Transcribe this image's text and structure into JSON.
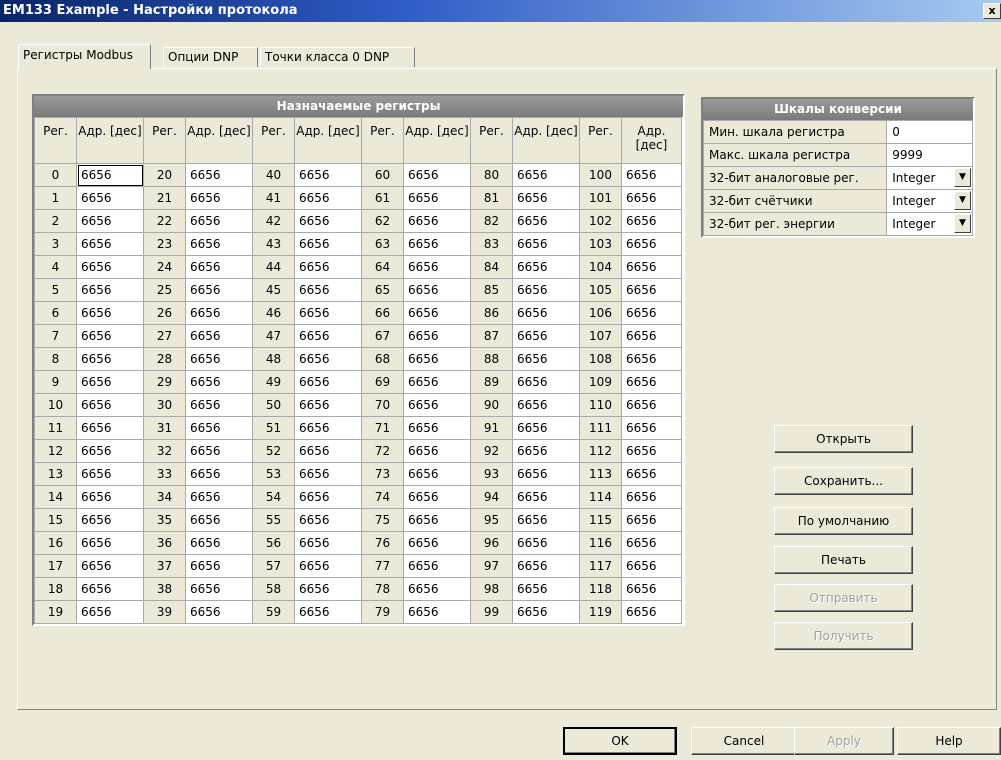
{
  "window": {
    "title": "EM133 Example - Настройки протокола",
    "close_label": "x"
  },
  "tabs": [
    {
      "label": "Регистры Modbus",
      "active": true
    },
    {
      "label": "Опции DNP"
    },
    {
      "label": "Точки класса 0 DNP"
    }
  ],
  "registers": {
    "header": "Назначаемые регистры",
    "reg_col_label": "Рег.",
    "addr_col_label": "Адр. [дес]",
    "rows": [
      [
        "0",
        "6656",
        "20",
        "6656",
        "40",
        "6656",
        "60",
        "6656",
        "80",
        "6656",
        "100",
        "6656"
      ],
      [
        "1",
        "6656",
        "21",
        "6656",
        "41",
        "6656",
        "61",
        "6656",
        "81",
        "6656",
        "101",
        "6656"
      ],
      [
        "2",
        "6656",
        "22",
        "6656",
        "42",
        "6656",
        "62",
        "6656",
        "82",
        "6656",
        "102",
        "6656"
      ],
      [
        "3",
        "6656",
        "23",
        "6656",
        "43",
        "6656",
        "63",
        "6656",
        "83",
        "6656",
        "103",
        "6656"
      ],
      [
        "4",
        "6656",
        "24",
        "6656",
        "44",
        "6656",
        "64",
        "6656",
        "84",
        "6656",
        "104",
        "6656"
      ],
      [
        "5",
        "6656",
        "25",
        "6656",
        "45",
        "6656",
        "65",
        "6656",
        "85",
        "6656",
        "105",
        "6656"
      ],
      [
        "6",
        "6656",
        "26",
        "6656",
        "46",
        "6656",
        "66",
        "6656",
        "86",
        "6656",
        "106",
        "6656"
      ],
      [
        "7",
        "6656",
        "27",
        "6656",
        "47",
        "6656",
        "67",
        "6656",
        "87",
        "6656",
        "107",
        "6656"
      ],
      [
        "8",
        "6656",
        "28",
        "6656",
        "48",
        "6656",
        "68",
        "6656",
        "88",
        "6656",
        "108",
        "6656"
      ],
      [
        "9",
        "6656",
        "29",
        "6656",
        "49",
        "6656",
        "69",
        "6656",
        "89",
        "6656",
        "109",
        "6656"
      ],
      [
        "10",
        "6656",
        "30",
        "6656",
        "50",
        "6656",
        "70",
        "6656",
        "90",
        "6656",
        "110",
        "6656"
      ],
      [
        "11",
        "6656",
        "31",
        "6656",
        "51",
        "6656",
        "71",
        "6656",
        "91",
        "6656",
        "111",
        "6656"
      ],
      [
        "12",
        "6656",
        "32",
        "6656",
        "52",
        "6656",
        "72",
        "6656",
        "92",
        "6656",
        "112",
        "6656"
      ],
      [
        "13",
        "6656",
        "33",
        "6656",
        "53",
        "6656",
        "73",
        "6656",
        "93",
        "6656",
        "113",
        "6656"
      ],
      [
        "14",
        "6656",
        "34",
        "6656",
        "54",
        "6656",
        "74",
        "6656",
        "94",
        "6656",
        "114",
        "6656"
      ],
      [
        "15",
        "6656",
        "35",
        "6656",
        "55",
        "6656",
        "75",
        "6656",
        "95",
        "6656",
        "115",
        "6656"
      ],
      [
        "16",
        "6656",
        "36",
        "6656",
        "56",
        "6656",
        "76",
        "6656",
        "96",
        "6656",
        "116",
        "6656"
      ],
      [
        "17",
        "6656",
        "37",
        "6656",
        "57",
        "6656",
        "77",
        "6656",
        "97",
        "6656",
        "117",
        "6656"
      ],
      [
        "18",
        "6656",
        "38",
        "6656",
        "58",
        "6656",
        "78",
        "6656",
        "98",
        "6656",
        "118",
        "6656"
      ],
      [
        "19",
        "6656",
        "39",
        "6656",
        "59",
        "6656",
        "79",
        "6656",
        "99",
        "6656",
        "119",
        "6656"
      ]
    ]
  },
  "scales": {
    "header": "Шкалы конверсии",
    "rows": [
      {
        "label": "Мин. шкала регистра",
        "value": "0",
        "dropdown": false
      },
      {
        "label": "Макс. шкала регистра",
        "value": "9999",
        "dropdown": false
      },
      {
        "label": "32-бит аналоговые рег.",
        "value": "Integer",
        "dropdown": true
      },
      {
        "label": "32-бит счётчики",
        "value": "Integer",
        "dropdown": true
      },
      {
        "label": "32-бит рег. энергии",
        "value": "Integer",
        "dropdown": true
      }
    ]
  },
  "actions": {
    "open": "Открыть",
    "save": "Сохранить...",
    "default": "По умолчанию",
    "print": "Печать",
    "send": "Отправить",
    "receive": "Получить"
  },
  "footer": {
    "ok": "OK",
    "cancel": "Cancel",
    "apply": "Apply",
    "help": "Help"
  }
}
